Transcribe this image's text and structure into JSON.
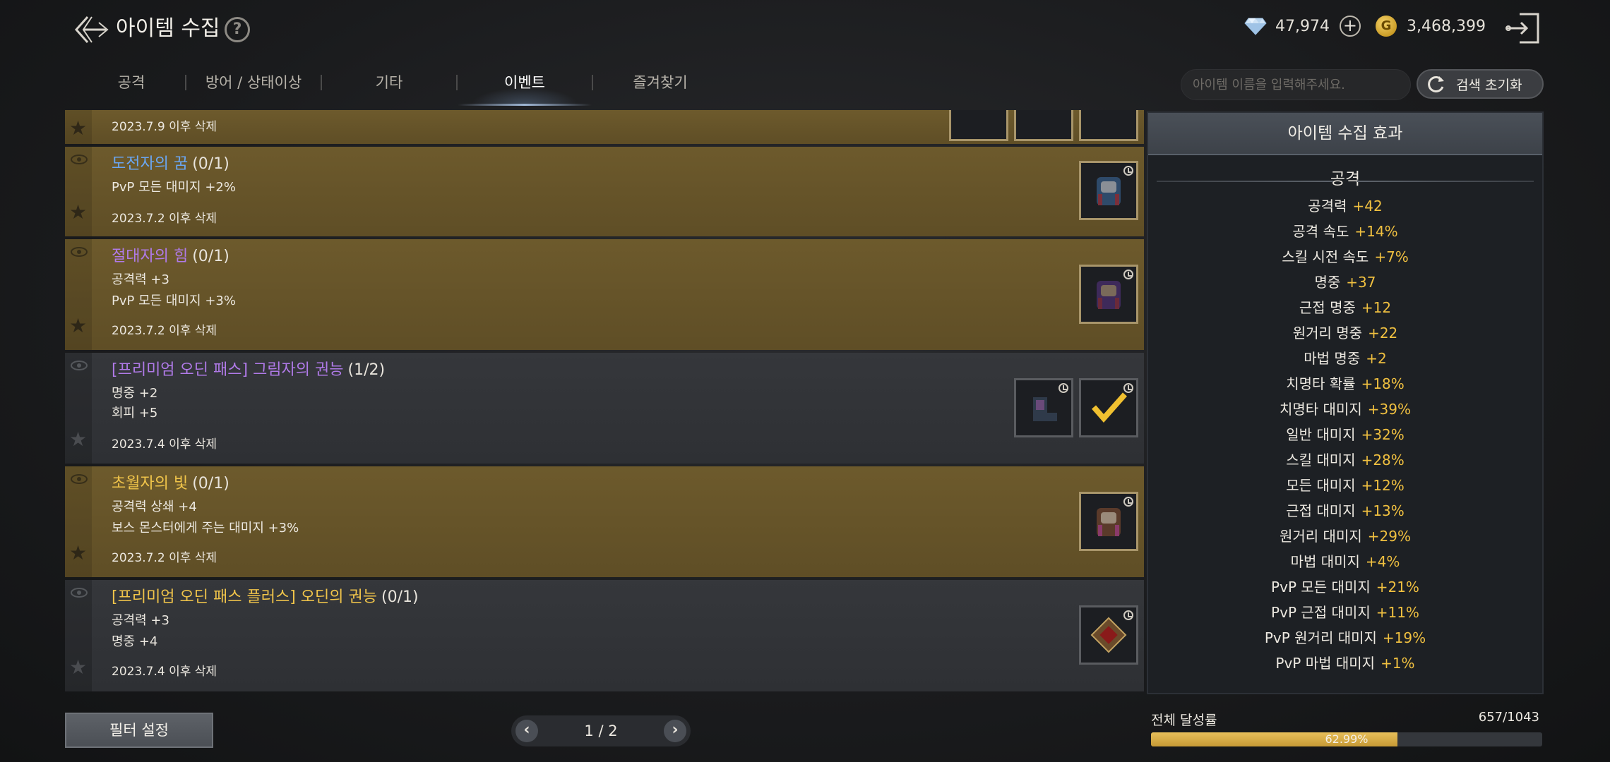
{
  "header": {
    "title": "아이템 수집",
    "help_icon": "question-circle-icon",
    "back_icon": "back-arrow-icon",
    "exit_icon": "exit-door-icon",
    "diamonds": "47,974",
    "gold": "3,468,399",
    "gold_symbol": "G",
    "plus": "+"
  },
  "tabs": [
    {
      "label": "공격"
    },
    {
      "label": "방어 / 상태이상"
    },
    {
      "label": "기타"
    },
    {
      "label": "이벤트"
    },
    {
      "label": "즐겨찾기"
    }
  ],
  "active_tab": "이벤트",
  "search": {
    "placeholder": "아이템 이름을 입력해주세요.",
    "reset_label": "검색 초기화"
  },
  "rows": [
    {
      "date": "2023.7.9 이후 삭제"
    },
    {
      "title": "도전자의 꿈",
      "count": "(0/1)",
      "stats": [
        "PvP 모든 대미지 +2%"
      ],
      "date": "2023.7.2 이후 삭제"
    },
    {
      "title": "절대자의 힘",
      "count": "(0/1)",
      "stats": [
        "공격력 +3",
        "PvP 모든 대미지 +3%"
      ],
      "date": "2023.7.2 이후 삭제"
    },
    {
      "title": "[프리미엄 오딘 패스] 그림자의 권능",
      "count": "(1/2)",
      "stats": [
        "명중 +2",
        "회피 +5"
      ],
      "date": "2023.7.4 이후 삭제"
    },
    {
      "title": "초월자의 빛",
      "count": "(0/1)",
      "stats": [
        "공격력 상쇄 +4",
        "보스 몬스터에게 주는 대미지 +3%"
      ],
      "date": "2023.7.2 이후 삭제"
    },
    {
      "title": "[프리미엄 오딘 패스 플러스] 오딘의 권능",
      "count": "(0/1)",
      "stats": [
        "공격력 +3",
        "명중 +4"
      ],
      "date": "2023.7.4 이후 삭제"
    }
  ],
  "colors": {
    "gold_row": "#6d5a2c",
    "gray_row": "#35373b",
    "blue_title": "#6aa6f2",
    "purple_title": "#b07ae8",
    "gold_title": "#f0c44a",
    "value": "#f0c040"
  },
  "panel": {
    "header": "아이템 수집 효과",
    "category": "공격",
    "effects": [
      {
        "name": "공격력",
        "value": "+42"
      },
      {
        "name": "공격 속도",
        "value": "+14%"
      },
      {
        "name": "스킬 시전 속도",
        "value": "+7%"
      },
      {
        "name": "명중",
        "value": "+37"
      },
      {
        "name": "근접 명중",
        "value": "+12"
      },
      {
        "name": "원거리 명중",
        "value": "+22"
      },
      {
        "name": "마법 명중",
        "value": "+2"
      },
      {
        "name": "치명타 확률",
        "value": "+18%"
      },
      {
        "name": "치명타 대미지",
        "value": "+39%"
      },
      {
        "name": "일반 대미지",
        "value": "+32%"
      },
      {
        "name": "스킬 대미지",
        "value": "+28%"
      },
      {
        "name": "모든 대미지",
        "value": "+12%"
      },
      {
        "name": "근접 대미지",
        "value": "+13%"
      },
      {
        "name": "원거리 대미지",
        "value": "+29%"
      },
      {
        "name": "마법 대미지",
        "value": "+4%"
      },
      {
        "name": "PvP 모든 대미지",
        "value": "+21%"
      },
      {
        "name": "PvP 근접 대미지",
        "value": "+11%"
      },
      {
        "name": "PvP 원거리 대미지",
        "value": "+19%"
      },
      {
        "name": "PvP 마법 대미지",
        "value": "+1%"
      }
    ]
  },
  "footer": {
    "filter_label": "필터 설정",
    "page": "1 / 2",
    "prev": "‹",
    "next": "›",
    "progress_label": "전체 달성률",
    "progress_count": "657/1043",
    "progress_pct": "62.99%",
    "progress_fraction": 0.6299
  }
}
